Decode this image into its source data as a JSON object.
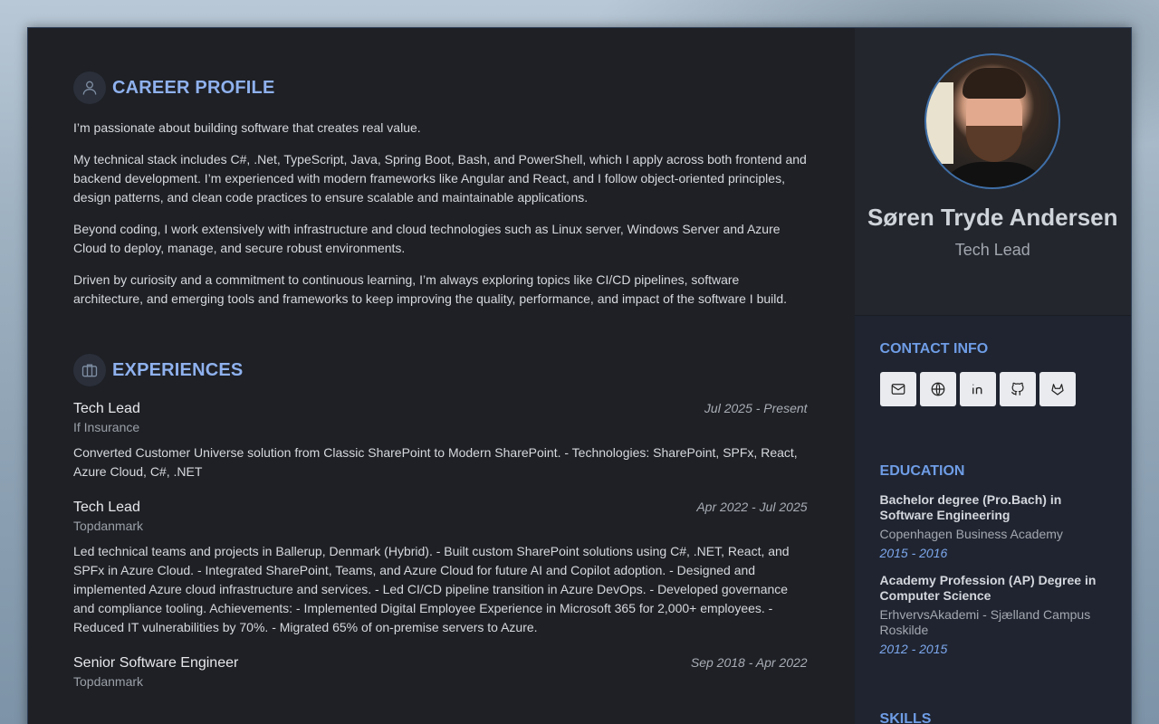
{
  "profile": {
    "title": "CAREER PROFILE",
    "paragraphs": [
      "I’m passionate about building software that creates real value.",
      "My technical stack includes C#, .Net, TypeScript, Java, Spring Boot, Bash, and PowerShell, which I apply across both frontend and backend development. I’m experienced with modern frameworks like Angular and React, and I follow object-oriented principles, design patterns, and clean code practices to ensure scalable and maintainable applications.",
      "Beyond coding, I work extensively with infrastructure and cloud technologies such as Linux server, Windows Server and Azure Cloud to deploy, manage, and secure robust environments.",
      "Driven by curiosity and a commitment to continuous learning, I’m always exploring topics like CI/CD pipelines, software architecture, and emerging tools and frameworks to keep improving the quality, performance, and impact of the software I build."
    ]
  },
  "experiences": {
    "title": "EXPERIENCES",
    "jobs": [
      {
        "title": "Tech Lead",
        "date": "Jul 2025 - Present",
        "company": "If Insurance",
        "desc": "Converted Customer Universe solution from Classic SharePoint to Modern SharePoint. - Technologies: SharePoint, SPFx, React, Azure Cloud, C#, .NET"
      },
      {
        "title": "Tech Lead",
        "date": "Apr 2022 - Jul 2025",
        "company": "Topdanmark",
        "desc": "Led technical teams and projects in Ballerup, Denmark (Hybrid). - Built custom SharePoint solutions using C#, .NET, React, and SPFx in Azure Cloud. - Integrated SharePoint, Teams, and Azure Cloud for future AI and Copilot adoption. - Designed and implemented Azure cloud infrastructure and services. - Led CI/CD pipeline transition in Azure DevOps. - Developed governance and compliance tooling. Achievements: - Implemented Digital Employee Experience in Microsoft 365 for 2,000+ employees. - Reduced IT vulnerabilities by 70%. - Migrated 65% of on-premise servers to Azure."
      },
      {
        "title": "Senior Software Engineer",
        "date": "Sep 2018 - Apr 2022",
        "company": "Topdanmark",
        "desc": ""
      }
    ]
  },
  "sidebar": {
    "name": "Søren Tryde Andersen",
    "role": "Tech Lead",
    "contact_title": "CONTACT INFO",
    "contact_icons": [
      "mail-icon",
      "globe-icon",
      "linkedin-icon",
      "github-icon",
      "gitlab-icon"
    ],
    "education_title": "EDUCATION",
    "education": [
      {
        "degree": "Bachelor degree (Pro.Bach) in Software Engineering",
        "school": "Copenhagen Business Academy",
        "years": "2015 - 2016"
      },
      {
        "degree": "Academy Profession (AP) Degree in Computer Science",
        "school": "ErhvervsAkademi - Sjælland Campus Roskilde",
        "years": "2012 - 2015"
      }
    ],
    "skills_title": "SKILLS"
  },
  "colors": {
    "accent": "#8fb1ee",
    "side_accent": "#6f9de6",
    "background": "#1e2025"
  }
}
